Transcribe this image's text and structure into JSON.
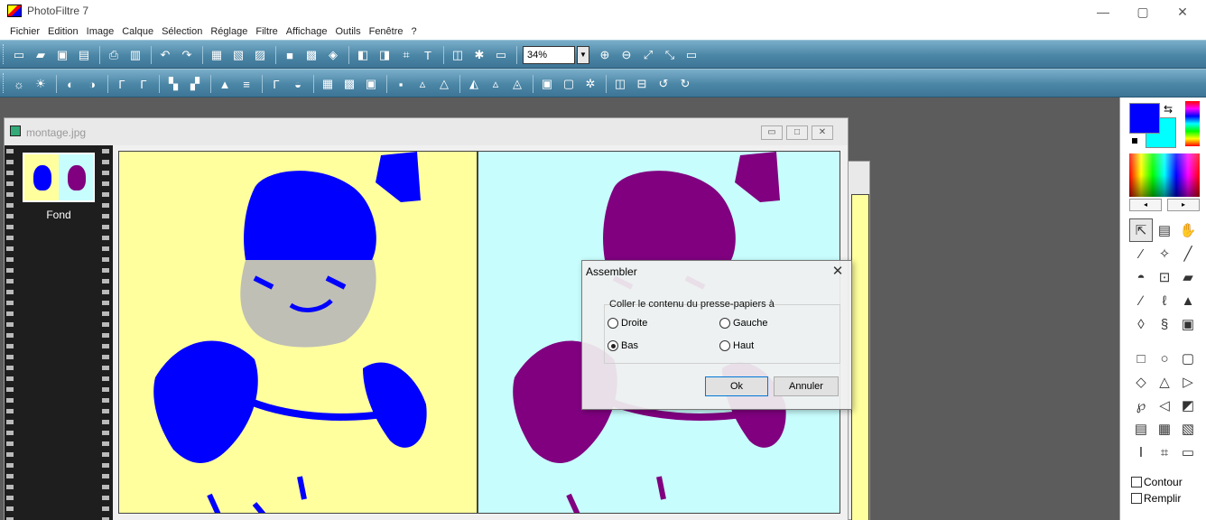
{
  "window": {
    "title": "PhotoFiltre 7",
    "min_label": "—",
    "max_label": "▢",
    "close_label": "✕"
  },
  "menu": [
    "Fichier",
    "Edition",
    "Image",
    "Calque",
    "Sélection",
    "Réglage",
    "Filtre",
    "Affichage",
    "Outils",
    "Fenêtre",
    "?"
  ],
  "toolbar": {
    "zoom_value": "34%",
    "zoom_dropdown": "▼",
    "row1_icons": [
      "new-icon",
      "open-icon",
      "save-icon",
      "browse-icon",
      "print-icon",
      "scan-icon",
      "undo-icon",
      "redo-icon",
      "paste-icon",
      "paste-new-icon",
      "copy-icon",
      "mask-icon",
      "palette-icon",
      "filter-icon",
      "image-size-icon",
      "canvas-size-icon",
      "crop-icon",
      "text-icon",
      "layer-icon",
      "effect-icon",
      "window-icon",
      "zoom-in-icon",
      "zoom-out-icon",
      "fit-icon",
      "actual-size-icon",
      "fullscreen-icon"
    ],
    "row2_icons": [
      "brightness-down-icon",
      "brightness-up-icon",
      "contrast-down-icon",
      "contrast-up-icon",
      "gamma-down-icon",
      "gamma-up-icon",
      "saturation-down-icon",
      "saturation-up-icon",
      "levels-icon",
      "equalize-icon",
      "auto-gamma-icon",
      "auto-contrast-icon",
      "grayscale-icon",
      "sepia-icon",
      "negative-icon",
      "blur-icon",
      "soften-icon",
      "sharpen-icon",
      "emboss-icon",
      "edge-icon",
      "relief-icon",
      "frame-icon",
      "border-icon",
      "texture-icon",
      "flip-h-icon",
      "flip-v-icon",
      "rotate-left-icon",
      "rotate-right-icon"
    ]
  },
  "document": {
    "title": "montage.jpg",
    "min_label": "▭",
    "max_label": "□",
    "close_label": "✕",
    "layer_label": "Fond"
  },
  "dialog": {
    "title": "Assembler",
    "close_label": "✕",
    "group_label": "Coller le contenu du presse-papiers à",
    "options": [
      {
        "label": "Droite",
        "checked": false
      },
      {
        "label": "Gauche",
        "checked": false
      },
      {
        "label": "Bas",
        "checked": true
      },
      {
        "label": "Haut",
        "checked": false
      }
    ],
    "ok_label": "Ok",
    "cancel_label": "Annuler"
  },
  "colors": {
    "foreground": "#0000ff",
    "background": "#00ffff",
    "image_left_bg": "#ffff9e",
    "image_right_bg": "#c8fdfd",
    "image_left_fg": "#0000ff",
    "image_right_fg": "#800080"
  },
  "right_panel": {
    "spectrum_left": "◂",
    "spectrum_right": "▸",
    "tools": [
      "pointer-icon",
      "layer-select-icon",
      "hand-icon",
      "picker-icon",
      "magic-wand-icon",
      "line-icon",
      "fill-icon",
      "spray-icon",
      "eraser-icon",
      "brush-icon",
      "smudge-icon",
      "stamp-icon",
      "blur-drop-icon",
      "deform-icon",
      "clone-icon"
    ],
    "shapes": [
      "rectangle-icon",
      "ellipse-icon",
      "rounded-rect-icon",
      "diamond-icon",
      "triangle-icon",
      "arrow-shape-icon",
      "lasso-icon",
      "polygon-icon",
      "open-shape-icon",
      "fit-icon",
      "ratio-4-3-icon",
      "ratio-3-2-icon",
      "text-frame-icon",
      "select-all-icon",
      "format-icon"
    ],
    "check_contour": "Contour",
    "check_fill": "Remplir"
  }
}
